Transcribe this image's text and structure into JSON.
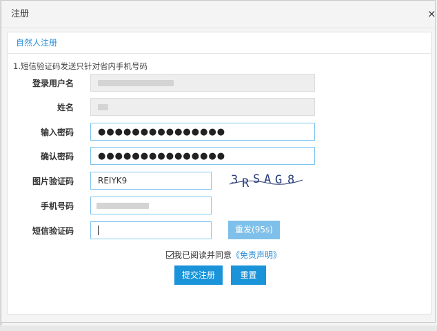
{
  "dialog": {
    "title": "注册",
    "close_icon": "×"
  },
  "tab": {
    "label": "自然人注册"
  },
  "note": "1.短信验证码发送只针对省内手机号码",
  "labels": {
    "username": "登录用户名",
    "name": "姓名",
    "password": "输入密码",
    "confirm": "确认密码",
    "image_code": "图片验证码",
    "phone": "手机号码",
    "sms_code": "短信验证码"
  },
  "fields": {
    "password_value": "●●●●●●●●●●●●●●●",
    "confirm_value": "●●●●●●●●●●●●●●●",
    "image_code_value": "REIYK9",
    "sms_code_value": ""
  },
  "captcha": {
    "text": "3RSAG8",
    "chars": [
      "3",
      "R",
      "S",
      "A",
      "G",
      "8"
    ]
  },
  "resend_button": "重发(95s)",
  "agreement": {
    "text": "我已阅读并同意",
    "link": "《免责声明》",
    "checked": true
  },
  "buttons": {
    "submit": "提交注册",
    "reset": "重置"
  },
  "colors": {
    "accent": "#1a93d9",
    "link": "#2a8ed5",
    "resend": "#7fc0ea",
    "input_border": "#7fc5f0"
  },
  "icons": {
    "close": "close-icon",
    "checkbox": "checkbox-checked-icon"
  }
}
